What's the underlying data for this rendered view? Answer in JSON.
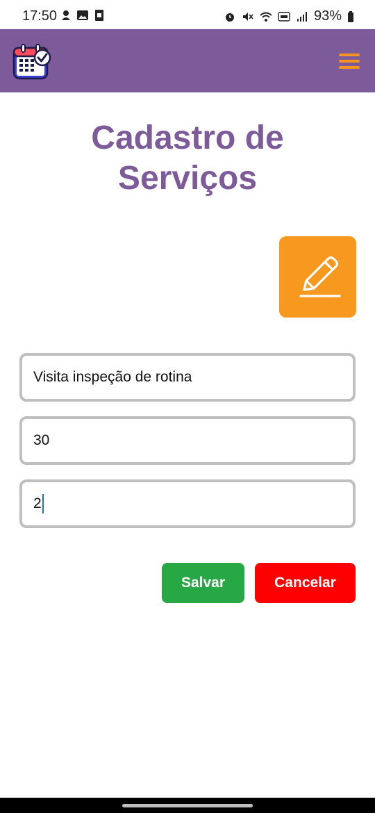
{
  "status_bar": {
    "time": "17:50",
    "battery": "93%",
    "left_icons": [
      "notification-icon",
      "gallery-icon",
      "sim-icon"
    ],
    "right_icons": [
      "alarm-icon",
      "mute-icon",
      "wifi-icon",
      "volte-icon",
      "signal-icon",
      "battery-icon"
    ]
  },
  "header": {
    "logo": "calendar-check-icon",
    "menu_icon": "hamburger-icon",
    "accent": "#7d5a99",
    "menu_color": "#f7941d"
  },
  "page": {
    "title_line1": "Cadastro de",
    "title_line2": "Serviços",
    "edit_icon": "pencil-icon"
  },
  "form": {
    "name_value": "Visita inspeção de rotina",
    "price_value": "30",
    "duration_value": "2"
  },
  "actions": {
    "save_label": "Salvar",
    "cancel_label": "Cancelar",
    "save_color": "#28a745",
    "cancel_color": "#ff0000"
  }
}
